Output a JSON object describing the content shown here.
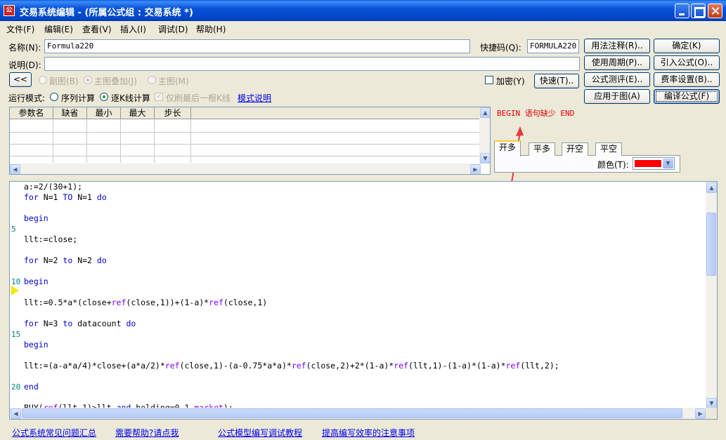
{
  "window": {
    "title": "交易系统编辑 - (所属公式组 : 交易系统 *)",
    "icon_text": "公"
  },
  "menu": [
    "文件(F)",
    "编辑(E)",
    "查看(V)",
    "插入(I)",
    "调试(D)",
    "帮助(H)"
  ],
  "form": {
    "name_label": "名称(N):",
    "name_value": "Formula220",
    "hotkey_label": "快捷码(Q):",
    "hotkey_value": "FORMULA220",
    "desc_label": "说明(D):",
    "desc_value": ""
  },
  "buttons": {
    "usage_note": "用法注释(R)..",
    "ok": "确定(K)",
    "period": "使用周期(P)..",
    "import": "引入公式(O)..",
    "collapse": "<<",
    "fast": "快速(T)..",
    "evaluate": "公式测评(E)..",
    "fee": "费率设置(B)..",
    "apply": "应用于图(A)",
    "compile": "编译公式(F)"
  },
  "chart_mode": {
    "sub": "副图(B)",
    "overlay": "主图叠加(J)",
    "main": "主图(M)",
    "encrypt": "加密(Y)"
  },
  "run_mode": {
    "label": "运行模式:",
    "sequence": "序列计算",
    "per_bar": "逐K线计算",
    "last_bar_only": "仅刷最后一根K线",
    "mode_help": "模式说明"
  },
  "param_table": {
    "headers": [
      "参数名",
      "缺省",
      "最小",
      "最大",
      "步长"
    ]
  },
  "error_message": "BEGIN 语句缺少 END",
  "signal_tabs": [
    "开多",
    "平多",
    "开空",
    "平空"
  ],
  "color_label": "颜色(T):",
  "colors": {
    "signal": "#ff0000",
    "title_bar": "#0853d8",
    "error": "#e00000"
  },
  "code_lines": [
    "a:=2/(30+1);",
    "for N=1 TO N=1 do",
    "",
    "begin",
    "",
    "llt:=close;",
    "",
    "for N=2 to N=2 do",
    "",
    "begin",
    "",
    "llt:=0.5*a*(close+ref(close,1))+(1-a)*ref(close,1)",
    "",
    "for N=3 to datacount do",
    "",
    "begin",
    "",
    "llt:=(a-a*a/4)*close+(a*a/2)*ref(close,1)-(a-0.75*a*a)*ref(close,2)+2*(1-a)*ref(llt,1)-(1-a)*(1-a)*ref(llt,2);",
    "",
    "end",
    "",
    "BUY(ref(llt,1)>llt and holding=0,1,market);"
  ],
  "line_numbers": [
    "5",
    "10",
    "15",
    "20"
  ],
  "footer_links": [
    "公式系统常见问题汇总",
    "需要帮助?请点我",
    "公式模型编写调试教程",
    "提高编写效率的注意事项"
  ]
}
